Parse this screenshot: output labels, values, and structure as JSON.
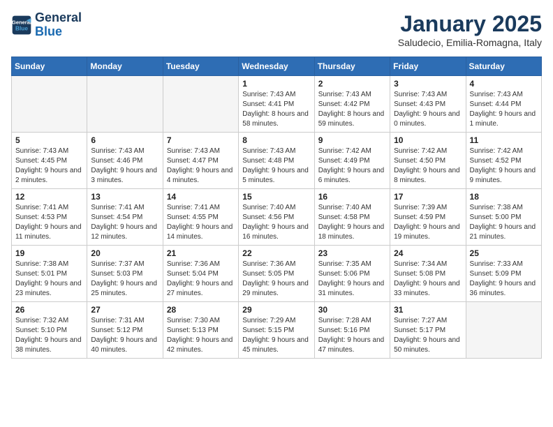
{
  "header": {
    "logo_line1": "General",
    "logo_line2": "Blue",
    "title": "January 2025",
    "subtitle": "Saludecio, Emilia-Romagna, Italy"
  },
  "days_of_week": [
    "Sunday",
    "Monday",
    "Tuesday",
    "Wednesday",
    "Thursday",
    "Friday",
    "Saturday"
  ],
  "weeks": [
    [
      {
        "day": "",
        "empty": true
      },
      {
        "day": "",
        "empty": true
      },
      {
        "day": "",
        "empty": true
      },
      {
        "day": "1",
        "sunrise": "7:43 AM",
        "sunset": "4:41 PM",
        "daylight": "8 hours and 58 minutes."
      },
      {
        "day": "2",
        "sunrise": "7:43 AM",
        "sunset": "4:42 PM",
        "daylight": "8 hours and 59 minutes."
      },
      {
        "day": "3",
        "sunrise": "7:43 AM",
        "sunset": "4:43 PM",
        "daylight": "9 hours and 0 minutes."
      },
      {
        "day": "4",
        "sunrise": "7:43 AM",
        "sunset": "4:44 PM",
        "daylight": "9 hours and 1 minute."
      }
    ],
    [
      {
        "day": "5",
        "sunrise": "7:43 AM",
        "sunset": "4:45 PM",
        "daylight": "9 hours and 2 minutes."
      },
      {
        "day": "6",
        "sunrise": "7:43 AM",
        "sunset": "4:46 PM",
        "daylight": "9 hours and 3 minutes."
      },
      {
        "day": "7",
        "sunrise": "7:43 AM",
        "sunset": "4:47 PM",
        "daylight": "9 hours and 4 minutes."
      },
      {
        "day": "8",
        "sunrise": "7:43 AM",
        "sunset": "4:48 PM",
        "daylight": "9 hours and 5 minutes."
      },
      {
        "day": "9",
        "sunrise": "7:42 AM",
        "sunset": "4:49 PM",
        "daylight": "9 hours and 6 minutes."
      },
      {
        "day": "10",
        "sunrise": "7:42 AM",
        "sunset": "4:50 PM",
        "daylight": "9 hours and 8 minutes."
      },
      {
        "day": "11",
        "sunrise": "7:42 AM",
        "sunset": "4:52 PM",
        "daylight": "9 hours and 9 minutes."
      }
    ],
    [
      {
        "day": "12",
        "sunrise": "7:41 AM",
        "sunset": "4:53 PM",
        "daylight": "9 hours and 11 minutes."
      },
      {
        "day": "13",
        "sunrise": "7:41 AM",
        "sunset": "4:54 PM",
        "daylight": "9 hours and 12 minutes."
      },
      {
        "day": "14",
        "sunrise": "7:41 AM",
        "sunset": "4:55 PM",
        "daylight": "9 hours and 14 minutes."
      },
      {
        "day": "15",
        "sunrise": "7:40 AM",
        "sunset": "4:56 PM",
        "daylight": "9 hours and 16 minutes."
      },
      {
        "day": "16",
        "sunrise": "7:40 AM",
        "sunset": "4:58 PM",
        "daylight": "9 hours and 18 minutes."
      },
      {
        "day": "17",
        "sunrise": "7:39 AM",
        "sunset": "4:59 PM",
        "daylight": "9 hours and 19 minutes."
      },
      {
        "day": "18",
        "sunrise": "7:38 AM",
        "sunset": "5:00 PM",
        "daylight": "9 hours and 21 minutes."
      }
    ],
    [
      {
        "day": "19",
        "sunrise": "7:38 AM",
        "sunset": "5:01 PM",
        "daylight": "9 hours and 23 minutes."
      },
      {
        "day": "20",
        "sunrise": "7:37 AM",
        "sunset": "5:03 PM",
        "daylight": "9 hours and 25 minutes."
      },
      {
        "day": "21",
        "sunrise": "7:36 AM",
        "sunset": "5:04 PM",
        "daylight": "9 hours and 27 minutes."
      },
      {
        "day": "22",
        "sunrise": "7:36 AM",
        "sunset": "5:05 PM",
        "daylight": "9 hours and 29 minutes."
      },
      {
        "day": "23",
        "sunrise": "7:35 AM",
        "sunset": "5:06 PM",
        "daylight": "9 hours and 31 minutes."
      },
      {
        "day": "24",
        "sunrise": "7:34 AM",
        "sunset": "5:08 PM",
        "daylight": "9 hours and 33 minutes."
      },
      {
        "day": "25",
        "sunrise": "7:33 AM",
        "sunset": "5:09 PM",
        "daylight": "9 hours and 36 minutes."
      }
    ],
    [
      {
        "day": "26",
        "sunrise": "7:32 AM",
        "sunset": "5:10 PM",
        "daylight": "9 hours and 38 minutes."
      },
      {
        "day": "27",
        "sunrise": "7:31 AM",
        "sunset": "5:12 PM",
        "daylight": "9 hours and 40 minutes."
      },
      {
        "day": "28",
        "sunrise": "7:30 AM",
        "sunset": "5:13 PM",
        "daylight": "9 hours and 42 minutes."
      },
      {
        "day": "29",
        "sunrise": "7:29 AM",
        "sunset": "5:15 PM",
        "daylight": "9 hours and 45 minutes."
      },
      {
        "day": "30",
        "sunrise": "7:28 AM",
        "sunset": "5:16 PM",
        "daylight": "9 hours and 47 minutes."
      },
      {
        "day": "31",
        "sunrise": "7:27 AM",
        "sunset": "5:17 PM",
        "daylight": "9 hours and 50 minutes."
      },
      {
        "day": "",
        "empty": true
      }
    ]
  ],
  "labels": {
    "sunrise_prefix": "Sunrise: ",
    "sunset_prefix": "Sunset: ",
    "daylight_prefix": "Daylight: "
  }
}
